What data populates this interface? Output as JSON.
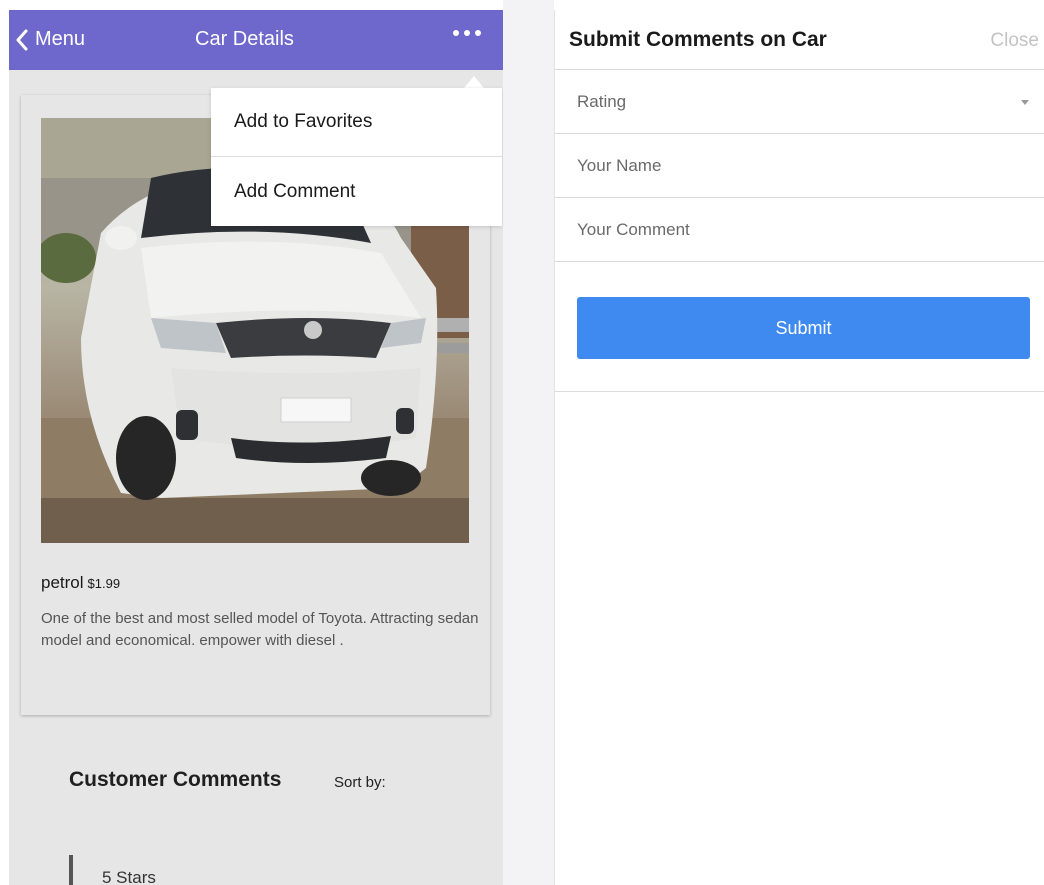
{
  "navbar": {
    "back_label": "Menu",
    "title": "Car Details",
    "more_icon": "more-horizontal-icon",
    "bg_color": "#6e68cc"
  },
  "dropdown": {
    "items": [
      {
        "label": "Add to Favorites"
      },
      {
        "label": "Add Comment"
      }
    ]
  },
  "product": {
    "name": "petrol",
    "price": "$1.99",
    "description": "One of the best and most selled model of Toyota. Attracting sedan model and economical. empower with diesel ."
  },
  "comments": {
    "heading": "Customer Comments",
    "sort_label": "Sort by:",
    "items": [
      {
        "stars": "5 Stars"
      }
    ]
  },
  "form": {
    "title": "Submit Comments on Car",
    "close_label": "Close",
    "rating_placeholder": "Rating",
    "name_placeholder": "Your Name",
    "comment_placeholder": "Your Comment",
    "submit_label": "Submit",
    "submit_color": "#3f8af1"
  }
}
